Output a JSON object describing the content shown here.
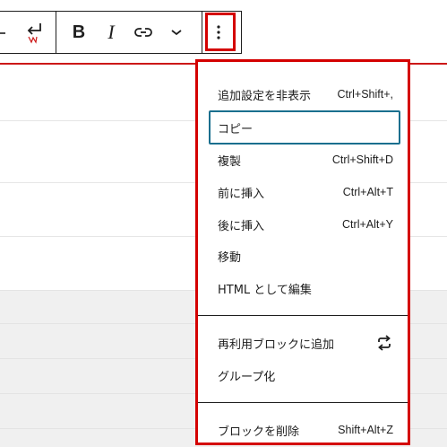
{
  "toolbar": {
    "buttons": [
      {
        "name": "undo",
        "icon": "arrow-left-icon"
      },
      {
        "name": "redo",
        "icon": "return-icon"
      },
      {
        "name": "bold",
        "label": "B"
      },
      {
        "name": "italic",
        "label": "I"
      },
      {
        "name": "link",
        "icon": "link-icon"
      },
      {
        "name": "more-format",
        "icon": "chevron-down-icon"
      },
      {
        "name": "options",
        "icon": "vertical-ellipsis-icon"
      }
    ],
    "bold_label": "B",
    "italic_label": "I",
    "options_label": "⋮"
  },
  "menu": {
    "group1": [
      {
        "label": "追加設定を非表示",
        "shortcut": "Ctrl+Shift+,"
      },
      {
        "label": "コピー",
        "shortcut": ""
      },
      {
        "label": "複製",
        "shortcut": "Ctrl+Shift+D"
      },
      {
        "label": "前に挿入",
        "shortcut": "Ctrl+Alt+T"
      },
      {
        "label": "後に挿入",
        "shortcut": "Ctrl+Alt+Y"
      },
      {
        "label": "移動",
        "shortcut": ""
      },
      {
        "label": "HTML として編集",
        "shortcut": ""
      }
    ],
    "group2": [
      {
        "label": "再利用ブロックに追加",
        "icon": "reusable-icon"
      },
      {
        "label": "グループ化"
      }
    ],
    "group3": [
      {
        "label": "ブロックを削除",
        "shortcut": "Shift+Alt+Z"
      }
    ]
  },
  "colors": {
    "highlight": "#d40000",
    "focus": "#1a6f8e",
    "editor_rule": "#cc1818"
  }
}
